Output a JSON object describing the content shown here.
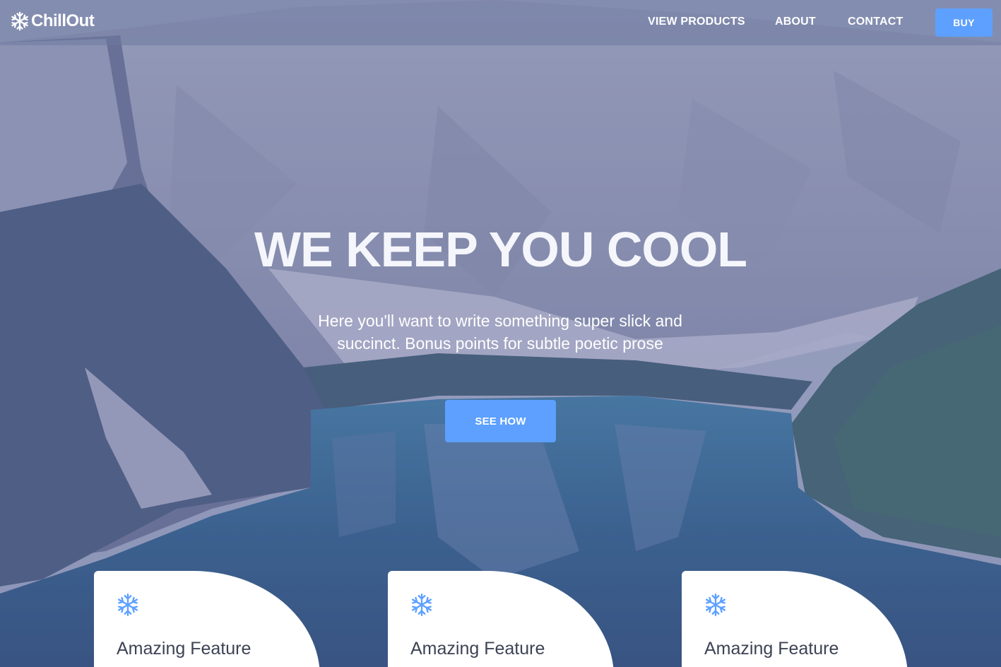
{
  "brand": {
    "name": "ChillOut",
    "icon": "snowflake-icon"
  },
  "nav": {
    "links": [
      "VIEW PRODUCTS",
      "ABOUT",
      "CONTACT"
    ],
    "buy_label": "BUY"
  },
  "hero": {
    "title": "WE KEEP YOU COOL",
    "subtitle": "Here you'll want to write something super slick and succinct. Bonus points for subtle poetic prose",
    "cta_label": "SEE HOW"
  },
  "features": [
    {
      "icon": "snowflake-icon",
      "title": "Amazing Feature"
    },
    {
      "icon": "snowflake-icon",
      "title": "Amazing Feature"
    },
    {
      "icon": "snowflake-icon",
      "title": "Amazing Feature"
    }
  ],
  "colors": {
    "accent": "#5da0ff",
    "card_title": "#3c4354",
    "white": "#ffffff"
  }
}
